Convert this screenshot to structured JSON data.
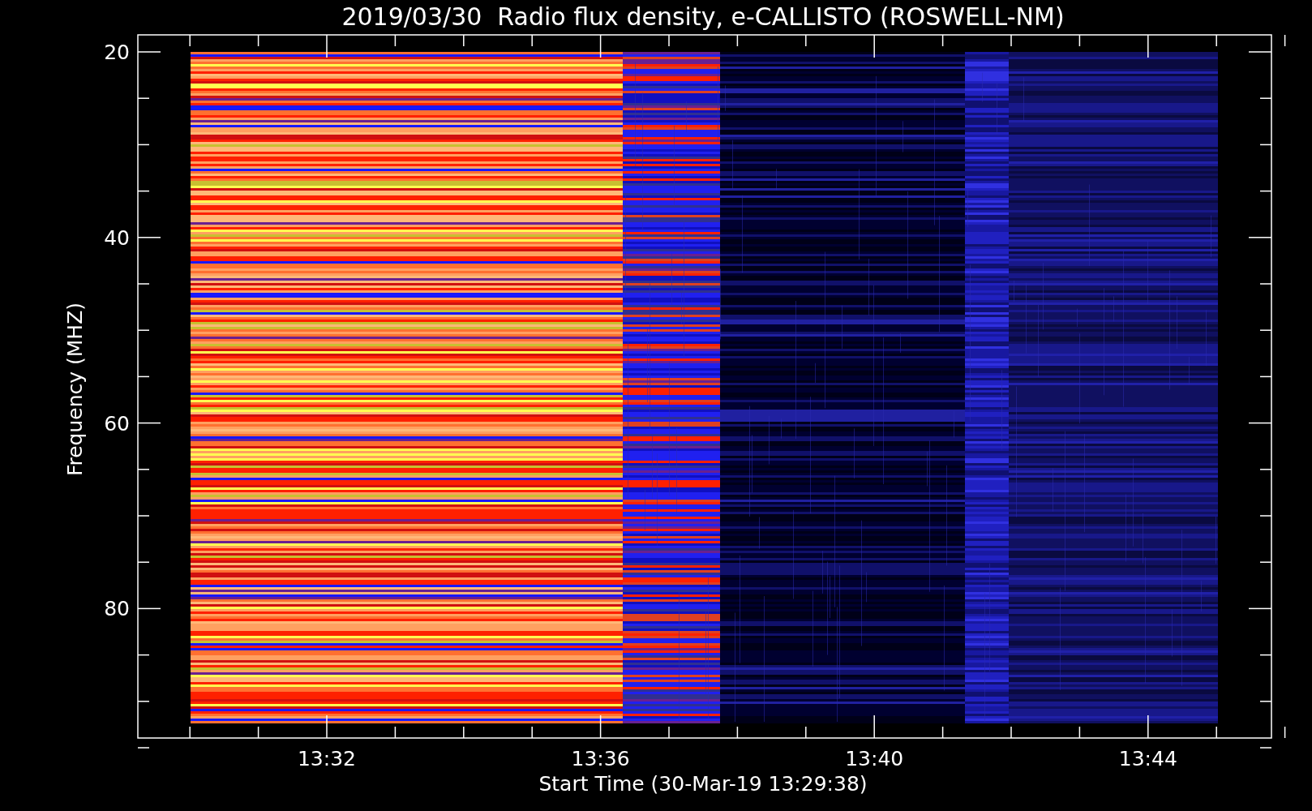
{
  "plot": {
    "title": "2019/03/30  Radio flux density, e-CALLISTO (ROSWELL-NM)",
    "y_axis": {
      "title": "Frequency (MHZ)",
      "tick_labels": [
        "20",
        "40",
        "60",
        "80"
      ]
    },
    "x_axis": {
      "title": "Start Time (30-Mar-19 13:29:38)",
      "tick_labels": [
        "13:32",
        "13:36",
        "13:40",
        "13:44"
      ]
    }
  }
}
